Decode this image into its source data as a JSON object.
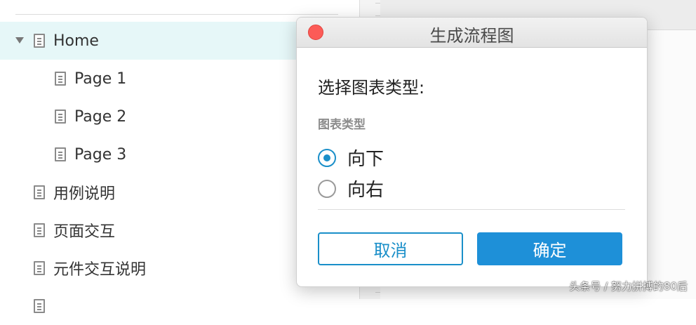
{
  "sidebar": {
    "items": [
      {
        "label": "Home",
        "expanded": true,
        "selected": true
      },
      {
        "label": "Page 1"
      },
      {
        "label": "Page 2"
      },
      {
        "label": "Page 3"
      },
      {
        "label": "用例说明"
      },
      {
        "label": "页面交互"
      },
      {
        "label": "元件交互说明"
      }
    ]
  },
  "dialog": {
    "title": "生成流程图",
    "prompt": "选择图表类型:",
    "group_label": "图表类型",
    "options": [
      {
        "label": "向下",
        "checked": true
      },
      {
        "label": "向右",
        "checked": false
      }
    ],
    "cancel_label": "取消",
    "ok_label": "确定"
  },
  "watermark": "头条号 / 努力拼搏的80后",
  "colors": {
    "accent": "#1e90d8",
    "selected_row": "#e6f7f8",
    "close_button": "#fc5b57"
  },
  "icons": {
    "tree_page": "page-icon",
    "tree_toggle": "caret-down-icon",
    "dialog_close": "close-icon"
  }
}
